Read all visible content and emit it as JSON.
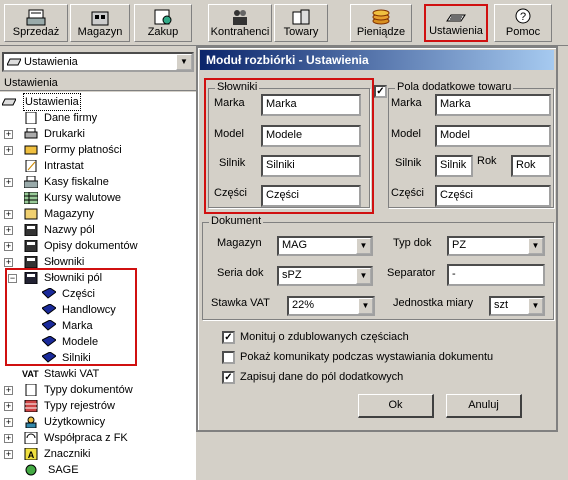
{
  "toolbar": {
    "buttons": [
      {
        "label": "Sprzedaż"
      },
      {
        "label": "Magazyn"
      },
      {
        "label": "Zakup"
      },
      {
        "label": "Kontrahenci"
      },
      {
        "label": "Towary"
      },
      {
        "label": "Pieniądze"
      },
      {
        "label": "Ustawienia"
      },
      {
        "label": "Pomoc"
      }
    ]
  },
  "left": {
    "combo_value": "Ustawienia",
    "tree_header": "Ustawienia",
    "tree": {
      "root": "Ustawienia",
      "items": [
        "Dane firmy",
        "Drukarki",
        "Formy płatności",
        "Intrastat",
        "Kasy fiskalne",
        "Kursy walutowe",
        "Magazyny",
        "Nazwy pól",
        "Opisy dokumentów",
        "Słowniki",
        "Słowniki pól"
      ],
      "subitems": [
        "Części",
        "Handlowcy",
        "Marka",
        "Modele",
        "Silniki"
      ],
      "items2": [
        "Stawki VAT",
        "Typy dokumentów",
        "Typy rejestrów",
        "Użytkownicy",
        "Współpraca z FK",
        "Znaczniki",
        "SAGE"
      ]
    },
    "vat_badge": "VAT"
  },
  "dialog": {
    "title": "Moduł rozbiórki - Ustawienia",
    "slowniki": {
      "title": "Słowniki",
      "marka_label": "Marka",
      "marka_value": "Marka",
      "model_label": "Model",
      "model_value": "Modele",
      "silnik_label": "Silnik",
      "silnik_value": "Silniki",
      "czesci_label": "Części",
      "czesci_value": "Części"
    },
    "pola": {
      "title": "Pola dodatkowe towaru",
      "checked": true,
      "marka_label": "Marka",
      "marka_value": "Marka",
      "model_label": "Model",
      "model_value": "Model",
      "silnik_label": "Silnik",
      "silnik_value": "Silnik",
      "rok_label": "Rok",
      "rok_value": "Rok",
      "czesci_label": "Części",
      "czesci_value": "Części"
    },
    "dokument": {
      "title": "Dokument",
      "magazyn_label": "Magazyn",
      "magazyn_value": "MAG",
      "typ_label": "Typ dok",
      "typ_value": "PZ",
      "seria_label": "Seria dok",
      "seria_value": "sPZ",
      "separator_label": "Separator",
      "separator_value": "-",
      "vat_label": "Stawka VAT",
      "vat_value": "22%",
      "jm_label": "Jednostka miary",
      "jm_value": "szt"
    },
    "options": [
      {
        "label": "Monituj o zdublowanych częściach",
        "checked": true
      },
      {
        "label": "Pokaż komunikaty podczas wystawiania dokumentu",
        "checked": false
      },
      {
        "label": "Zapisuj dane do pól dodatkowych",
        "checked": true
      }
    ],
    "ok_label": "Ok",
    "cancel_label": "Anuluj"
  },
  "colors": {
    "highlight": "#d01010",
    "title_start": "#0a246a",
    "title_end": "#a6caf0"
  }
}
